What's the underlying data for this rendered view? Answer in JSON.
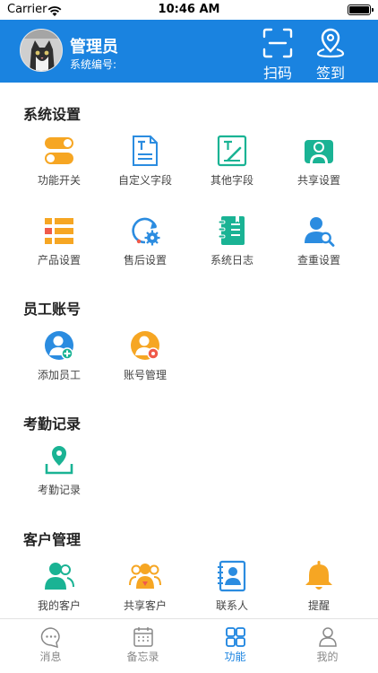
{
  "status_bar": {
    "carrier": "Carrier",
    "time": "10:46 AM"
  },
  "header": {
    "user_name": "管理员",
    "user_id_label": "系统编号:",
    "scan_label": "扫码",
    "checkin_label": "签到"
  },
  "sections": [
    {
      "title": "系统设置",
      "items": [
        {
          "label": "功能开关",
          "icon": "toggle-icon"
        },
        {
          "label": "自定义字段",
          "icon": "text-field-icon"
        },
        {
          "label": "其他字段",
          "icon": "text-edit-icon"
        },
        {
          "label": "共享设置",
          "icon": "share-users-icon"
        },
        {
          "label": "产品设置",
          "icon": "list-icon"
        },
        {
          "label": "售后设置",
          "icon": "refresh-gear-icon"
        },
        {
          "label": "系统日志",
          "icon": "notebook-icon"
        },
        {
          "label": "查重设置",
          "icon": "user-search-icon"
        }
      ]
    },
    {
      "title": "员工账号",
      "items": [
        {
          "label": "添加员工",
          "icon": "add-user-icon"
        },
        {
          "label": "账号管理",
          "icon": "user-settings-icon"
        }
      ]
    },
    {
      "title": "考勤记录",
      "items": [
        {
          "label": "考勤记录",
          "icon": "location-inbox-icon"
        }
      ]
    },
    {
      "title": "客户管理",
      "items": [
        {
          "label": "我的客户",
          "icon": "my-customers-icon"
        },
        {
          "label": "共享客户",
          "icon": "shared-customers-icon"
        },
        {
          "label": "联系人",
          "icon": "contact-card-icon"
        },
        {
          "label": "提醒",
          "icon": "bell-icon"
        }
      ]
    }
  ],
  "tabbar": {
    "items": [
      {
        "label": "消息",
        "icon": "message-icon",
        "active": false
      },
      {
        "label": "备忘录",
        "icon": "calendar-icon",
        "active": false
      },
      {
        "label": "功能",
        "icon": "grid-icon",
        "active": true
      },
      {
        "label": "我的",
        "icon": "person-icon",
        "active": false
      }
    ]
  },
  "colors": {
    "primary": "#1a83e0",
    "orange": "#f6a623",
    "teal": "#1ab394",
    "blue": "#2b8ce0",
    "red": "#f05a4a"
  }
}
